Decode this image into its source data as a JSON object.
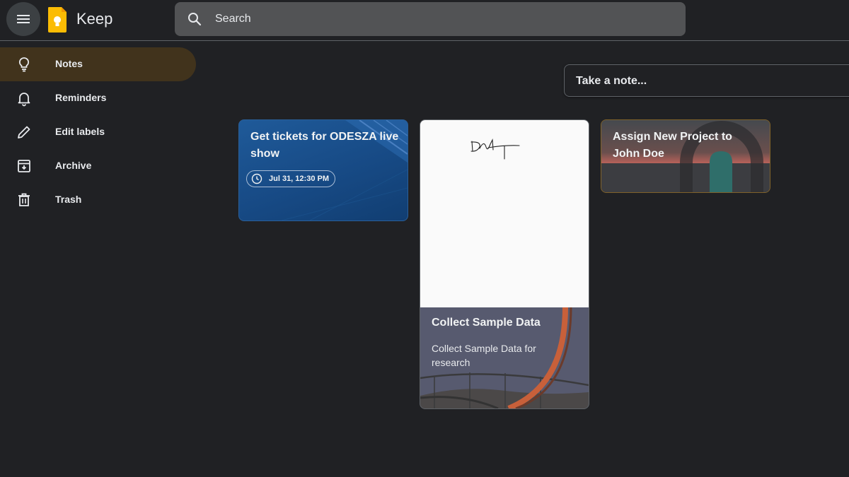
{
  "app": {
    "title": "Keep"
  },
  "search": {
    "placeholder": "Search"
  },
  "sidebar": {
    "items": [
      {
        "label": "Notes",
        "icon": "lightbulb-icon",
        "active": true
      },
      {
        "label": "Reminders",
        "icon": "bell-icon"
      },
      {
        "label": "Edit labels",
        "icon": "pencil-icon"
      },
      {
        "label": "Archive",
        "icon": "archive-icon"
      },
      {
        "label": "Trash",
        "icon": "trash-icon"
      }
    ]
  },
  "take_note": {
    "placeholder": "Take a note..."
  },
  "notes": [
    {
      "title": "Get tickets for ODESZA live show",
      "reminder": "Jul 31, 12:30 PM",
      "color": "#174a85"
    },
    {
      "title": "Collect Sample Data",
      "body": "Collect Sample Data for research",
      "has_drawing": true,
      "color": "#575a6f"
    },
    {
      "title": "Assign New Project to John Doe",
      "color": "#3a3b3f"
    }
  ],
  "colors": {
    "background": "#202124",
    "active_nav": "#41331c",
    "search_bg": "#525355",
    "logo_yellow": "#fbbc04"
  }
}
